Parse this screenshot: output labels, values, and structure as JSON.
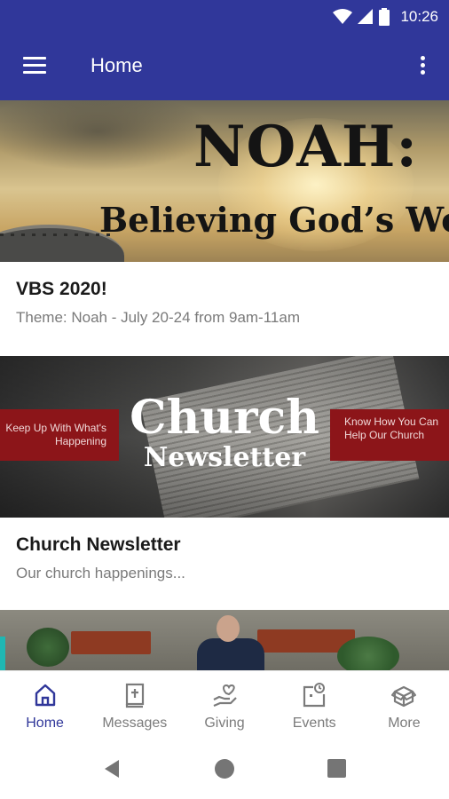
{
  "status_bar": {
    "time": "10:26",
    "icons": [
      "wifi-icon",
      "cell-signal-icon",
      "battery-icon"
    ]
  },
  "app_bar": {
    "title": "Home",
    "menu_icon": "hamburger-menu-icon",
    "overflow_icon": "more-vert-icon"
  },
  "feed": [
    {
      "banner": {
        "title": "NOAH:",
        "subtitle": "Believing God’s Word"
      },
      "title": "VBS 2020!",
      "subtitle": "Theme: Noah - July 20-24 from 9am-11am"
    },
    {
      "banner": {
        "title_line1": "Church",
        "title_line2": "Newsletter",
        "left_box": "Keep Up With What's Happening",
        "right_box": "Know How You Can Help Our Church"
      },
      "title": "Church Newsletter",
      "subtitle": "Our church happenings..."
    }
  ],
  "bottom_nav": {
    "items": [
      {
        "label": "Home",
        "icon": "home-icon",
        "active": true
      },
      {
        "label": "Messages",
        "icon": "bible-icon",
        "active": false
      },
      {
        "label": "Giving",
        "icon": "giving-heart-hand-icon",
        "active": false
      },
      {
        "label": "Events",
        "icon": "calendar-icon",
        "active": false
      },
      {
        "label": "More",
        "icon": "open-box-icon",
        "active": false
      }
    ]
  },
  "colors": {
    "primary": "#30379a",
    "banner_red": "#8c1519",
    "nav_inactive": "#7b7b7b"
  }
}
